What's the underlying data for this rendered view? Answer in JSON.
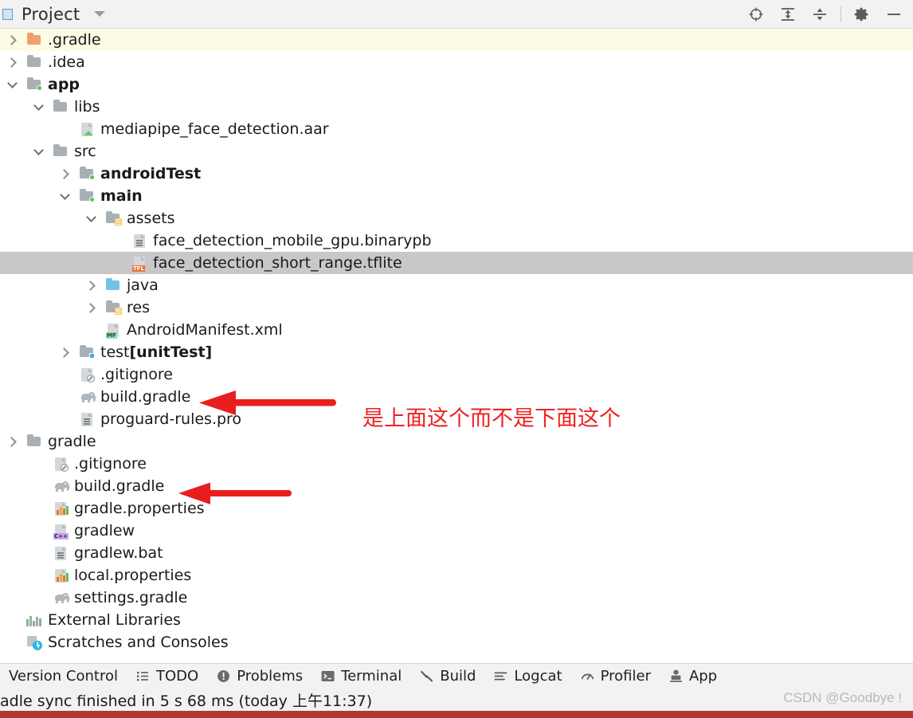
{
  "header": {
    "title": "Project",
    "dropdown_icon": "chevron-down-icon",
    "tools": [
      {
        "name": "locate-icon",
        "label": "Select Opened File"
      },
      {
        "name": "expand-all-icon",
        "label": "Expand All"
      },
      {
        "name": "collapse-all-icon",
        "label": "Collapse All"
      },
      {
        "name": "gear-icon",
        "label": "Settings"
      },
      {
        "name": "minimize-icon",
        "label": "Hide"
      }
    ]
  },
  "tree": {
    "rows": [
      {
        "label": ".gradle",
        "indent": 0,
        "chevron": "right",
        "icon": "folder-orange",
        "bold": false,
        "state": "yellow"
      },
      {
        "label": ".idea",
        "indent": 0,
        "chevron": "right",
        "icon": "folder-gray",
        "bold": false,
        "state": "none"
      },
      {
        "label": "app",
        "indent": 0,
        "chevron": "down",
        "icon": "folder-module",
        "bold": true,
        "state": "none"
      },
      {
        "label": "libs",
        "indent": 1,
        "chevron": "down",
        "icon": "folder-gray",
        "bold": false,
        "state": "none"
      },
      {
        "label": "mediapipe_face_detection.aar",
        "indent": 2,
        "chevron": "none",
        "icon": "aar-file",
        "bold": false,
        "state": "none"
      },
      {
        "label": "src",
        "indent": 1,
        "chevron": "down",
        "icon": "folder-gray",
        "bold": false,
        "state": "none"
      },
      {
        "label": "androidTest",
        "indent": 2,
        "chevron": "right",
        "icon": "folder-module",
        "bold": true,
        "state": "none"
      },
      {
        "label": "main",
        "indent": 2,
        "chevron": "down",
        "icon": "folder-module",
        "bold": true,
        "state": "none"
      },
      {
        "label": "assets",
        "indent": 3,
        "chevron": "down",
        "icon": "folder-resource",
        "bold": false,
        "state": "none"
      },
      {
        "label": "face_detection_mobile_gpu.binarypb",
        "indent": 4,
        "chevron": "none",
        "icon": "file-plain",
        "bold": false,
        "state": "none"
      },
      {
        "label": "face_detection_short_range.tflite",
        "indent": 4,
        "chevron": "none",
        "icon": "file-tfl",
        "bold": false,
        "state": "selected"
      },
      {
        "label": "java",
        "indent": 3,
        "chevron": "right",
        "icon": "folder-blue",
        "bold": false,
        "state": "none"
      },
      {
        "label": "res",
        "indent": 3,
        "chevron": "right",
        "icon": "folder-resource",
        "bold": false,
        "state": "none"
      },
      {
        "label": "AndroidManifest.xml",
        "indent": 3,
        "chevron": "none",
        "icon": "file-mf",
        "bold": false,
        "state": "none"
      },
      {
        "label": "test ",
        "suffix": "[unitTest]",
        "indent": 2,
        "chevron": "right",
        "icon": "folder-test",
        "bold": false,
        "state": "none"
      },
      {
        "label": ".gitignore",
        "indent": 2,
        "chevron": "none",
        "icon": "file-gitignore",
        "bold": false,
        "state": "none"
      },
      {
        "label": "build.gradle",
        "indent": 2,
        "chevron": "none",
        "icon": "gradle-elephant",
        "bold": false,
        "state": "none"
      },
      {
        "label": "proguard-rules.pro",
        "indent": 2,
        "chevron": "none",
        "icon": "file-plain",
        "bold": false,
        "state": "none"
      },
      {
        "label": "gradle",
        "indent": 0,
        "chevron": "right",
        "icon": "folder-gray",
        "bold": false,
        "state": "none"
      },
      {
        "label": ".gitignore",
        "indent": 1,
        "chevron": "none",
        "icon": "file-gitignore",
        "bold": false,
        "state": "none"
      },
      {
        "label": "build.gradle",
        "indent": 1,
        "chevron": "none",
        "icon": "gradle-elephant",
        "bold": false,
        "state": "none"
      },
      {
        "label": "gradle.properties",
        "indent": 1,
        "chevron": "none",
        "icon": "file-properties",
        "bold": false,
        "state": "none"
      },
      {
        "label": "gradlew",
        "indent": 1,
        "chevron": "none",
        "icon": "file-cpp",
        "bold": false,
        "state": "none"
      },
      {
        "label": "gradlew.bat",
        "indent": 1,
        "chevron": "none",
        "icon": "file-plain",
        "bold": false,
        "state": "none"
      },
      {
        "label": "local.properties",
        "indent": 1,
        "chevron": "none",
        "icon": "file-properties",
        "bold": false,
        "state": "none"
      },
      {
        "label": "settings.gradle",
        "indent": 1,
        "chevron": "none",
        "icon": "gradle-elephant",
        "bold": false,
        "state": "none"
      },
      {
        "label": "External Libraries",
        "indent": 0,
        "chevron": "none",
        "icon": "external-libraries",
        "bold": false,
        "state": "none"
      },
      {
        "label": "Scratches and Consoles",
        "indent": 0,
        "chevron": "none",
        "icon": "scratches",
        "bold": false,
        "state": "none"
      }
    ]
  },
  "annotations": {
    "note_text": "是上面这个而不是下面这个",
    "note_color": "#ee2222",
    "arrows": [
      {
        "name": "arrow-to-app-build-gradle",
        "points_to": "build.gradle"
      },
      {
        "name": "arrow-to-project-build-gradle",
        "points_to": "build.gradle"
      }
    ]
  },
  "bottom_bar": {
    "items": [
      {
        "label": "Version Control",
        "icon": "none"
      },
      {
        "label": "TODO",
        "icon": "list-icon"
      },
      {
        "label": "Problems",
        "icon": "exclamation-circle-icon"
      },
      {
        "label": "Terminal",
        "icon": "terminal-icon"
      },
      {
        "label": "Build",
        "icon": "hammer-icon"
      },
      {
        "label": "Logcat",
        "icon": "lines-icon"
      },
      {
        "label": "Profiler",
        "icon": "gauge-icon"
      },
      {
        "label": "App",
        "icon": "app-inspection-icon"
      }
    ]
  },
  "status_bar": {
    "message": "adle sync finished in 5 s 68 ms (today 上午11:37)"
  },
  "watermark": {
    "text": "CSDN @Goodbye !"
  }
}
